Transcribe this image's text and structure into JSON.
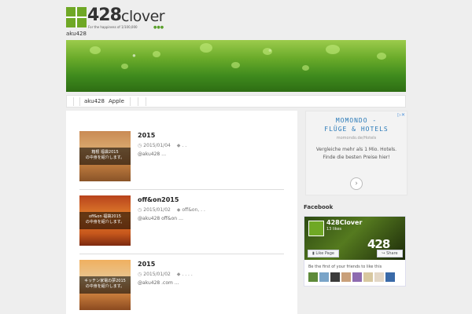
{
  "header": {
    "logo_number": "428",
    "logo_word": "clover",
    "logo_tagline": "For the happiness of 1/100,000",
    "logo_dots": "●●●",
    "site_description": "aku428"
  },
  "nav": {
    "items": [
      "aku428",
      "Apple"
    ]
  },
  "posts": [
    {
      "title": "2015",
      "date": "2015/01/04",
      "tags": ". .",
      "excerpt": "@aku428  …",
      "thumb_caption_1": "箱根 福袋2015",
      "thumb_caption_2": "の中身を紹介します。"
    },
    {
      "title": "off&on2015",
      "date": "2015/01/02",
      "tags": "off&on, . .",
      "excerpt": "@aku428 off&on …",
      "thumb_caption_1": "off&on 福袋2015",
      "thumb_caption_2": "の中身を紹介します。"
    },
    {
      "title": "2015",
      "date": "2015/01/02",
      "tags": ". . . .",
      "excerpt": "@aku428  .com …",
      "thumb_caption_1": "キッチン家電の夢2015",
      "thumb_caption_2": "の中身を紹介します。"
    }
  ],
  "ad": {
    "brand_line1": "MOMONDO -",
    "brand_line2": "FLÜGE & HOTELS",
    "url": "momondo.de/Hotels",
    "copy": "Vergleiche mehr als 1 Mio. Hotels. Finde die besten Preise hier!",
    "arrow": "›"
  },
  "facebook": {
    "heading": "Facebook",
    "page_name": "428Clover",
    "likes": "13 likes",
    "cover_text": "428",
    "like_button": "Like Page",
    "share_button": "Share",
    "friends_text": "Be the first of your friends to like this"
  },
  "colors": {
    "brand_green": "#6fa825",
    "ad_blue": "#2a7ab8"
  }
}
